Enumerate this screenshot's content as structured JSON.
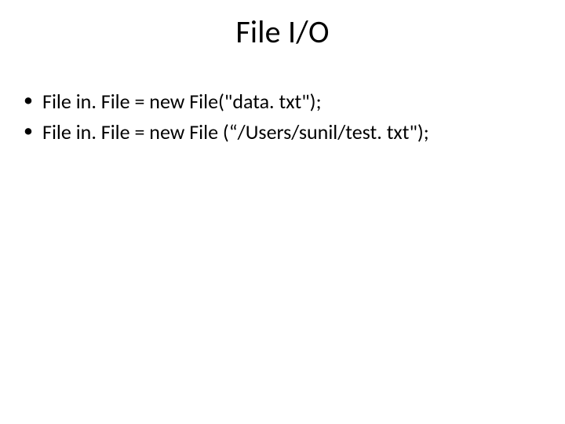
{
  "slide": {
    "title": "File I/O",
    "bullets": [
      "File in. File = new File(\"data. txt\");",
      "File in. File = new File (“/Users/sunil/test. txt\");"
    ]
  }
}
